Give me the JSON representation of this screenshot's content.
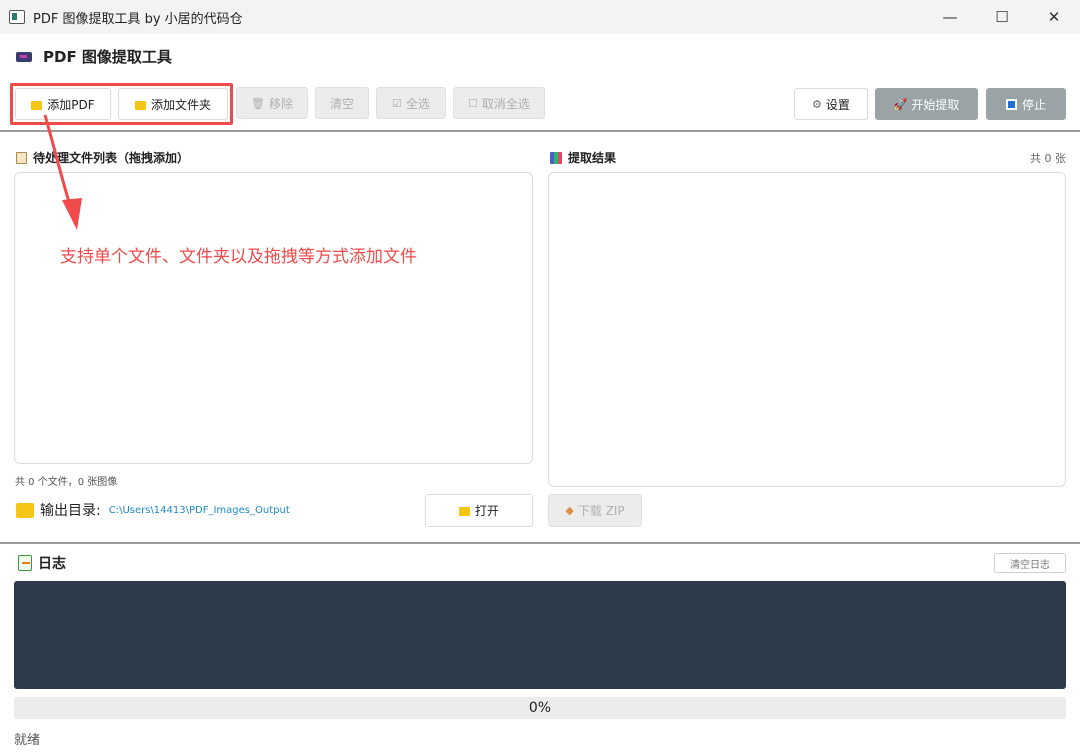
{
  "window": {
    "title": "PDF 图像提取工具 by 小居的代码仓",
    "controls": {
      "minimize": "—",
      "maximize": "☐",
      "close": "✕"
    }
  },
  "header": {
    "title": "PDF 图像提取工具"
  },
  "toolbar": {
    "add_pdf": "添加PDF",
    "add_folder": "添加文件夹",
    "remove": "移除",
    "clear": "清空",
    "select_all": "全选",
    "deselect_all": "取消全选",
    "settings": "设置",
    "start": "开始提取",
    "stop": "停止"
  },
  "file_panel": {
    "title": "待处理文件列表（拖拽添加）",
    "summary": "共 0 个文件，0 张图像"
  },
  "result_panel": {
    "title": "提取结果",
    "count": "共 0 张"
  },
  "output": {
    "label": "输出目录:",
    "path": "C:\\Users\\14413\\PDF_Images_Output",
    "open_button": "打开",
    "download_zip": "下载 ZIP"
  },
  "log": {
    "title": "日志",
    "clear_button": "清空日志"
  },
  "progress": {
    "value": 0,
    "label": "0%"
  },
  "status": "就绪",
  "annotation": {
    "text": "支持单个文件、文件夹以及拖拽等方式添加文件",
    "color": "#f04a4a"
  },
  "icons": [
    "app-icon",
    "logo-icon",
    "folder-icon",
    "trash-icon",
    "check-icon",
    "checkbox-icon",
    "gear-icon",
    "rocket-icon",
    "stop-icon",
    "clipboard-icon",
    "results-icon",
    "box-icon",
    "log-icon"
  ]
}
